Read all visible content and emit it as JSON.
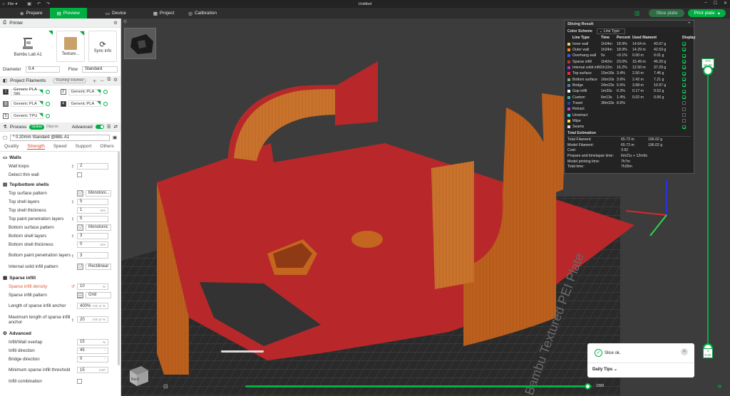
{
  "window": {
    "title": "Untitled",
    "file_menu": "File"
  },
  "nav": {
    "tabs": [
      "Prepare",
      "Preview",
      "Device",
      "Project",
      "Calibration"
    ],
    "slice_plate": "Slice plate",
    "print_plate": "Print plate"
  },
  "printer": {
    "header": "Printer",
    "printer_name": "Bambu Lab A1",
    "plate_name": "Texture...",
    "sync": "Sync info",
    "diameter_label": "Diameter",
    "diameter_value": "0.4",
    "flow_label": "Flow",
    "flow_value": "Standard"
  },
  "filaments": {
    "header": "Project Filaments",
    "chip": "Flushing volumes",
    "items": [
      {
        "num": "1",
        "name": "Generic PLA Silk"
      },
      {
        "num": "2",
        "name": "Generic PLA"
      },
      {
        "num": "3",
        "name": "Generic PLA"
      },
      {
        "num": "4",
        "name": "Generic PLA"
      },
      {
        "num": "5",
        "name": "Generic TPU"
      }
    ]
  },
  "process": {
    "header": "Process",
    "chip_global": "Global",
    "chip_objects": "Objects",
    "advanced": "Advanced",
    "preset": "* 0.20mm Standard @BBL A1",
    "tabs": [
      "Quality",
      "Strength",
      "Speed",
      "Support",
      "Others"
    ]
  },
  "params": {
    "walls": "Walls",
    "wall_loops": {
      "label": "Wall loops",
      "value": "2"
    },
    "detect_thin_wall": {
      "label": "Detect thin wall"
    },
    "topbottom": "Top/bottom shells",
    "top_surface_pattern": {
      "label": "Top surface pattern",
      "value": "Monotoni..."
    },
    "top_shell_layers": {
      "label": "Top shell layers",
      "value": "5"
    },
    "top_shell_thickness": {
      "label": "Top shell thickness",
      "value": "1",
      "unit": "mm"
    },
    "top_paint": {
      "label": "Top paint penetration layers",
      "value": "5"
    },
    "bottom_surface_pattern": {
      "label": "Bottom surface pattern",
      "value": "Monotonic"
    },
    "bottom_shell_layers": {
      "label": "Bottom shell layers",
      "value": "3"
    },
    "bottom_shell_thickness": {
      "label": "Bottom shell thickness",
      "value": "0",
      "unit": "mm"
    },
    "bottom_paint": {
      "label": "Bottom paint penetration layers",
      "value": "3"
    },
    "internal_solid": {
      "label": "Internal solid infill pattern",
      "value": "Rectilinear"
    },
    "sparse": "Sparse infill",
    "sparse_density": {
      "label": "Sparse infill density",
      "value": "10",
      "unit": "%"
    },
    "sparse_pattern": {
      "label": "Sparse infill pattern",
      "value": "Grid"
    },
    "sparse_anchor": {
      "label": "Length of sparse infill anchor",
      "value": "400%",
      "unit": "mm or %"
    },
    "sparse_anchor_max": {
      "label": "Maximum length of sparse infill anchor",
      "value": "20",
      "unit": "mm or %"
    },
    "advanced": "Advanced",
    "infill_overlap": {
      "label": "Infill/Wall overlap",
      "value": "15",
      "unit": "%"
    },
    "infill_direction": {
      "label": "Infill direction",
      "value": "45",
      "unit": "°"
    },
    "bridge_direction": {
      "label": "Bridge direction",
      "value": "0",
      "unit": "°"
    },
    "min_sparse": {
      "label": "Minimum sparse infill threshold",
      "value": "15",
      "unit": "mm²"
    },
    "infill_combination": {
      "label": "Infill combination"
    }
  },
  "slicing": {
    "title": "Slicing Result",
    "color_scheme_label": "Color Scheme",
    "color_scheme_value": "Line Type",
    "headers": [
      "Line Type",
      "Time",
      "Percent",
      "Used filament",
      "Display"
    ],
    "rows": [
      {
        "name": "Inner wall",
        "color": "#f5d442",
        "time": "1h24m",
        "pct": "18.9%",
        "len": "14.64 m",
        "wt": "43.67 g",
        "show": true
      },
      {
        "name": "Outer wall",
        "color": "#ff8c1a",
        "time": "1h24m",
        "pct": "18.9%",
        "len": "14.29 m",
        "wt": "42.63 g",
        "show": true
      },
      {
        "name": "Overhang wall",
        "color": "#3b5bdb",
        "time": "5s",
        "pct": "<0.1%",
        "len": "0.00 m",
        "wt": "0.01 g",
        "show": true
      },
      {
        "name": "Sparse infill",
        "color": "#c8312b",
        "time": "1h42m",
        "pct": "23.0%",
        "len": "15.49 m",
        "wt": "46.20 g",
        "show": true
      },
      {
        "name": "Internal solid infill",
        "color": "#a03cc8",
        "time": "1h12m",
        "pct": "16.2%",
        "len": "12.50 m",
        "wt": "37.29 g",
        "show": true
      },
      {
        "name": "Top surface",
        "color": "#e8303a",
        "time": "15m18s",
        "pct": "3.4%",
        "len": "2.50 m",
        "wt": "7.46 g",
        "show": true
      },
      {
        "name": "Bottom surface",
        "color": "#7fa874",
        "time": "16m10s",
        "pct": "3.6%",
        "len": "2.42 m",
        "wt": "7.21 g",
        "show": true
      },
      {
        "name": "Bridge",
        "color": "#4f7faf",
        "time": "24m23s",
        "pct": "5.5%",
        "len": "3.68 m",
        "wt": "10.97 g",
        "show": true
      },
      {
        "name": "Gap infill",
        "color": "#ffffff",
        "time": "1m33s",
        "pct": "0.3%",
        "len": "0.17 m",
        "wt": "0.52 g",
        "show": true
      },
      {
        "name": "Custom",
        "color": "#46b4a0",
        "time": "6m13s",
        "pct": "1.4%",
        "len": "0.02 m",
        "wt": "0.06 g",
        "show": true
      },
      {
        "name": "Travel",
        "color": "#2040c8",
        "time": "38m33s",
        "pct": "8.6%",
        "len": "",
        "wt": "",
        "show": false
      },
      {
        "name": "Retract",
        "color": "#d83ad0",
        "time": "",
        "pct": "",
        "len": "",
        "wt": "",
        "show": false
      },
      {
        "name": "Unretract",
        "color": "#40c8e0",
        "time": "",
        "pct": "",
        "len": "",
        "wt": "",
        "show": false
      },
      {
        "name": "Wipe",
        "color": "#ffe43a",
        "time": "",
        "pct": "",
        "len": "",
        "wt": "",
        "show": false
      },
      {
        "name": "Seams",
        "color": "#e0e0e0",
        "time": "",
        "pct": "",
        "len": "",
        "wt": "",
        "show": true
      }
    ],
    "total_title": "Total Estimation",
    "totals": [
      {
        "label": "Total Filament:",
        "a": "65.72 m",
        "b": "196.02 g"
      },
      {
        "label": "Model Filament:",
        "a": "65.72 m",
        "b": "196.02 g"
      },
      {
        "label": "Cost:",
        "a": "3.92",
        "b": ""
      },
      {
        "label": "Prepare and timelapse time:",
        "a": "6m21s + 12m9s",
        "b": ""
      },
      {
        "label": "Model printing time:",
        "a": "7h7m",
        "b": ""
      },
      {
        "label": "Total time:",
        "a": "7h26m",
        "b": ""
      }
    ]
  },
  "toast": {
    "message": "Slice ok.",
    "tips": "Daily Tips"
  },
  "layers": {
    "top_layer": "473",
    "top_height": "82.60",
    "bottom_layer": "1",
    "bottom_height": "0.20",
    "horizontal_value": "2399",
    "horizontal_fraction": 0.99
  },
  "plate": {
    "label": "Bambu Textured PEI Plate"
  },
  "cube": {
    "face": "Back"
  }
}
